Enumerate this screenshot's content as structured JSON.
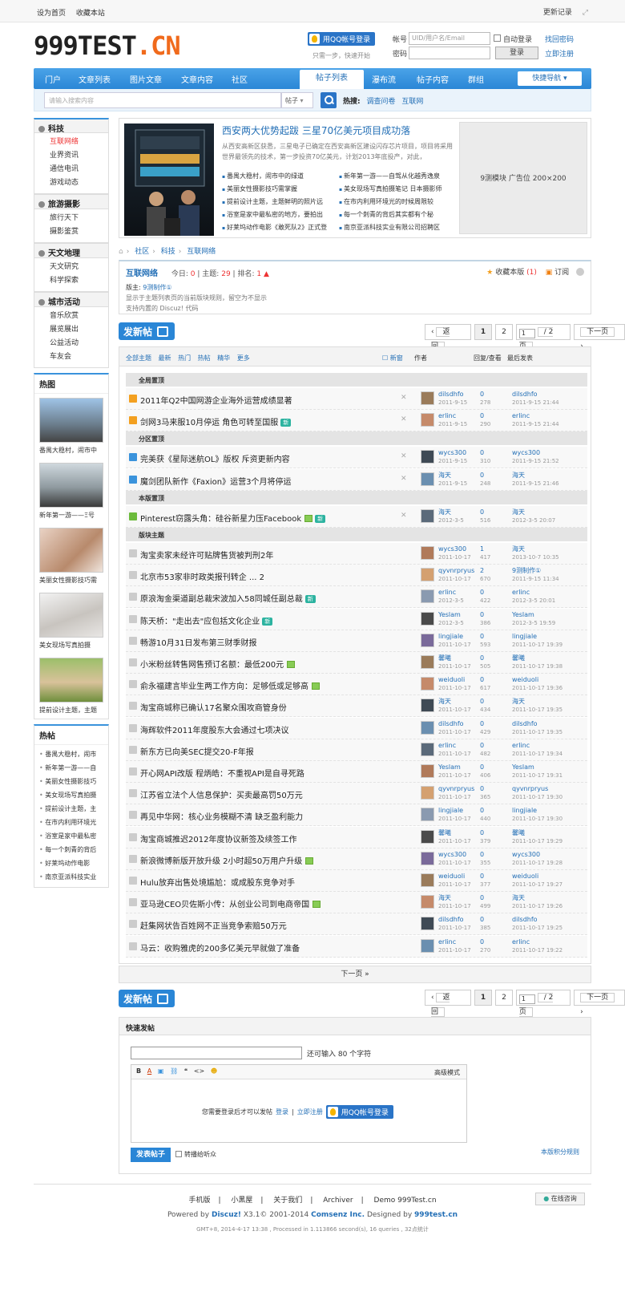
{
  "topbar": {
    "set_home": "设为首页",
    "bookmark": "收藏本站",
    "changelog": "更新记录"
  },
  "logo": {
    "main": "999TEST",
    "suffix": ".CN"
  },
  "login": {
    "qq_button": "用QQ帐号登录",
    "qq_hint": "只需一步，快速开始",
    "account_label": "帐号",
    "account_placeholder": "UID/用户名/Email",
    "auto_login": "自动登录",
    "find_password": "找回密码",
    "password_label": "密码",
    "login_button": "登录",
    "register": "立即注册"
  },
  "nav": {
    "items": [
      "门户",
      "文章列表",
      "图片文章",
      "文章内容",
      "社区",
      "帖子列表",
      "瀑布流",
      "帖子内容",
      "群组"
    ],
    "active": "帖子列表",
    "quick": "快捷导航"
  },
  "search": {
    "placeholder": "请输入搜索内容",
    "type": "帖子",
    "hot_label": "热搜:",
    "hot": [
      "调查问卷",
      "互联网"
    ]
  },
  "sidebar": {
    "groups": [
      {
        "title": "科技",
        "items": [
          "互联网络",
          "业界资讯",
          "通信电讯",
          "游戏动态"
        ],
        "current": "互联网络"
      },
      {
        "title": "旅游摄影",
        "items": [
          "旅行天下",
          "摄影鉴赏"
        ]
      },
      {
        "title": "天文地理",
        "items": [
          "天文研究",
          "科学探索"
        ]
      },
      {
        "title": "城市活动",
        "items": [
          "音乐欣赏",
          "展览展出",
          "公益活动",
          "车友会"
        ]
      }
    ],
    "hot_pic_title": "热图",
    "hot_pics": [
      "番禺大稳村，闹市中",
      "新年第一游——Ξ号",
      "美丽女性摄影技巧需",
      "美女现场写真拍摄",
      "提前设计主题，主题"
    ],
    "hot_post_title": "热帖",
    "hot_posts": [
      "番禺大稳村，闹市",
      "新年第一游——自",
      "美丽女性摄影技巧",
      "美女现场写真拍摄",
      "提前设计主题，主",
      "在市内利用环境光",
      "浴室是家中最私密",
      "每一个刺青的背后",
      "好莱坞动作电影",
      "南京亚派科技实业"
    ]
  },
  "featured": {
    "title": "西安两大优势起跋 三星70亿美元项目成功落",
    "desc": "从西安高新区获悉，三星电子已确定在西安高新区建设闪存芯片项目，项目将采用世界最领先的技术，第一步投资70亿美元，计划2013年底投产，对此，",
    "links": [
      "番禺大稳村，闹市中的绿道",
      "新年第一游——自驾从化越秀逸泉",
      "美丽女性摄影技巧需掌握",
      "美女现场写真拍摄笔记 日本摄影师",
      "提前设计主题，主题鲜明的照片远",
      "在市内利用环境光的时候周限较",
      "浴室是家中最私密的地方，要拍出",
      "每一个刺青的背后其实都有个秘",
      "好莱坞动作电影《敢死队2》正式登",
      "南京亚派科技实业有限公司招聘区"
    ],
    "ad": "9测模块 广告位 200×200"
  },
  "breadcrumb": [
    "社区",
    "科技",
    "互联网络"
  ],
  "forum": {
    "name": "互联网络",
    "today_label": "今日:",
    "today": "0",
    "topics_label": "主题:",
    "topics": "29",
    "rank_label": "排名:",
    "rank": "1",
    "moderator_label": "版主:",
    "moderator": "9测制作①",
    "favorite": "收藏本版",
    "favorite_count": "(1)",
    "subscribe": "订阅",
    "rule1": "显示于主题列表页的当前版块规则，留空为不显示",
    "rule2": "支持内置的 Discuz! 代码"
  },
  "toolbar": {
    "new_post": "发新帖",
    "back": "返 回",
    "page1": "1",
    "page2": "2",
    "page_input": "1",
    "page_total": "/ 2 页",
    "next": "下一页"
  },
  "threads": {
    "filters": [
      "全部主题",
      "最新",
      "热门",
      "热帖",
      "精华",
      "更多"
    ],
    "new_window": "新窗",
    "col_author": "作者",
    "col_reply": "回复/查看",
    "col_last": "最后发表",
    "sections": [
      "全局置顶",
      "分区置顶",
      "本版置顶",
      "版块主题"
    ],
    "rows": [
      {
        "title": "2011年Q2中国网游企业海外运营成绩显著",
        "tag": "",
        "img": false,
        "author": "dilsdhfo",
        "date": "2011-9-15",
        "reply": "0",
        "view": "278",
        "last": "dilsdhfo",
        "last_time": "2011-9-15 21:44",
        "x": true,
        "icon": "pin"
      },
      {
        "title": "剑网3马来服10月停运 角色可转至国服",
        "tag": "新",
        "img": false,
        "author": "erlinc",
        "date": "2011-9-15",
        "reply": "0",
        "view": "290",
        "last": "erlinc",
        "last_time": "2011-9-15 21:44",
        "x": true,
        "icon": "pin"
      },
      {
        "title": "完美获《星际迷航OL》版权 斥资更新内容",
        "tag": "",
        "img": false,
        "author": "wycs300",
        "date": "2011-9-15",
        "reply": "0",
        "view": "310",
        "last": "wycs300",
        "last_time": "2011-9-15 21:52",
        "x": true,
        "icon": "pin2"
      },
      {
        "title": "魔剑团队新作《Faxion》运营3个月将停运",
        "tag": "",
        "img": false,
        "author": "海天",
        "date": "2011-9-15",
        "reply": "0",
        "view": "248",
        "last": "海天",
        "last_time": "2011-9-15 21:46",
        "x": true,
        "icon": "pin2"
      },
      {
        "title": "Pinterest窃露头角：硅谷新星力压Facebook",
        "tag": "新",
        "img": true,
        "author": "海天",
        "date": "2012-3-5",
        "reply": "0",
        "view": "516",
        "last": "海天",
        "last_time": "2012-3-5 20:07",
        "x": true,
        "icon": "pin3"
      },
      {
        "title": "淘宝卖家未经许可贴牌售货被判刑2年",
        "tag": "",
        "img": false,
        "author": "wycs300",
        "date": "2011-10-17",
        "reply": "1",
        "view": "417",
        "last": "海天",
        "last_time": "2013-10-7 10:35",
        "x": false,
        "icon": ""
      },
      {
        "title": "北京市53家非时政类报刊转企  ... 2",
        "tag": "",
        "img": false,
        "author": "qyvnrpryus",
        "date": "2011-10-17",
        "reply": "2",
        "view": "670",
        "last": "9测制作①",
        "last_time": "2011-9-15 11:34",
        "x": false,
        "icon": ""
      },
      {
        "title": "原浪淘金渠道副总裁宋波加入58同城任副总裁",
        "tag": "新",
        "img": false,
        "author": "erlinc",
        "date": "2012-3-5",
        "reply": "0",
        "view": "422",
        "last": "erlinc",
        "last_time": "2012-3-5 20:01",
        "x": false,
        "icon": ""
      },
      {
        "title": "陈天桥：\"走出去\"应包括文化企业",
        "tag": "新",
        "img": false,
        "author": "Yeslam",
        "date": "2012-3-5",
        "reply": "0",
        "view": "386",
        "last": "Yeslam",
        "last_time": "2012-3-5 19:59",
        "x": false,
        "icon": ""
      },
      {
        "title": "畅游10月31日发布第三财季财报",
        "tag": "",
        "img": false,
        "author": "lingjiale",
        "date": "2011-10-17",
        "reply": "0",
        "view": "593",
        "last": "lingjiale",
        "last_time": "2011-10-17 19:39",
        "x": false,
        "icon": ""
      },
      {
        "title": "小米粉丝转售网售预订名额：最低200元",
        "tag": "",
        "img": true,
        "author": "馨曦",
        "date": "2011-10-17",
        "reply": "0",
        "view": "505",
        "last": "馨曦",
        "last_time": "2011-10-17 19:38",
        "x": false,
        "icon": ""
      },
      {
        "title": "俞永福建言毕业生两工作方向：足够低或足够高",
        "tag": "",
        "img": true,
        "author": "weiduoli",
        "date": "2011-10-17",
        "reply": "0",
        "view": "617",
        "last": "weiduoli",
        "last_time": "2011-10-17 19:36",
        "x": false,
        "icon": ""
      },
      {
        "title": "淘宝商城称已确认17名聚众围攻商管身份",
        "tag": "",
        "img": false,
        "author": "海天",
        "date": "2011-10-17",
        "reply": "0",
        "view": "434",
        "last": "海天",
        "last_time": "2011-10-17 19:35",
        "x": false,
        "icon": ""
      },
      {
        "title": "海辉软件2011年度股东大会通过七项决议",
        "tag": "",
        "img": false,
        "author": "dilsdhfo",
        "date": "2011-10-17",
        "reply": "0",
        "view": "429",
        "last": "dilsdhfo",
        "last_time": "2011-10-17 19:35",
        "x": false,
        "icon": ""
      },
      {
        "title": "新东方已向美SEC提交20-F年报",
        "tag": "",
        "img": false,
        "author": "erlinc",
        "date": "2011-10-17",
        "reply": "0",
        "view": "482",
        "last": "erlinc",
        "last_time": "2011-10-17 19:34",
        "x": false,
        "icon": ""
      },
      {
        "title": "开心网API改版 程炳皓：不重视API是自寻死路",
        "tag": "",
        "img": false,
        "author": "Yeslam",
        "date": "2011-10-17",
        "reply": "0",
        "view": "406",
        "last": "Yeslam",
        "last_time": "2011-10-17 19:31",
        "x": false,
        "icon": ""
      },
      {
        "title": "江苏省立法个人信息保护：买卖最高罚50万元",
        "tag": "",
        "img": false,
        "author": "qyvnrpryus",
        "date": "2011-10-17",
        "reply": "0",
        "view": "365",
        "last": "qyvnrpryus",
        "last_time": "2011-10-17 19:30",
        "x": false,
        "icon": ""
      },
      {
        "title": "再见中华网：核心业务模糊不清 缺乏盈利能力",
        "tag": "",
        "img": false,
        "author": "lingjiale",
        "date": "2011-10-17",
        "reply": "0",
        "view": "440",
        "last": "lingjiale",
        "last_time": "2011-10-17 19:30",
        "x": false,
        "icon": ""
      },
      {
        "title": "淘宝商城推迟2012年度协议新签及续签工作",
        "tag": "",
        "img": false,
        "author": "馨曦",
        "date": "2011-10-17",
        "reply": "0",
        "view": "379",
        "last": "馨曦",
        "last_time": "2011-10-17 19:29",
        "x": false,
        "icon": ""
      },
      {
        "title": "新浪微博新版开放升级 2小时超50万用户升级",
        "tag": "",
        "img": true,
        "author": "wycs300",
        "date": "2011-10-17",
        "reply": "0",
        "view": "355",
        "last": "wycs300",
        "last_time": "2011-10-17 19:28",
        "x": false,
        "icon": ""
      },
      {
        "title": "Hulu放弃出售处境尴尬：或成股东竞争对手",
        "tag": "",
        "img": false,
        "author": "weiduoli",
        "date": "2011-10-17",
        "reply": "0",
        "view": "377",
        "last": "weiduoli",
        "last_time": "2011-10-17 19:27",
        "x": false,
        "icon": ""
      },
      {
        "title": "亚马逊CEO贝佐斯小传：从创业公司到电商帝国",
        "tag": "",
        "img": true,
        "author": "海天",
        "date": "2011-10-17",
        "reply": "0",
        "view": "499",
        "last": "海天",
        "last_time": "2011-10-17 19:26",
        "x": false,
        "icon": ""
      },
      {
        "title": "赶集网状告百姓网不正当竞争索赔50万元",
        "tag": "",
        "img": false,
        "author": "dilsdhfo",
        "date": "2011-10-17",
        "reply": "0",
        "view": "385",
        "last": "dilsdhfo",
        "last_time": "2011-10-17 19:25",
        "x": false,
        "icon": ""
      },
      {
        "title": "马云：收购雅虎的200多亿美元早就做了准备",
        "tag": "",
        "img": false,
        "author": "erlinc",
        "date": "2011-10-17",
        "reply": "0",
        "view": "270",
        "last": "erlinc",
        "last_time": "2011-10-17 19:22",
        "x": false,
        "icon": ""
      }
    ]
  },
  "next_page": "下一页 »",
  "quickpost": {
    "title": "快速发帖",
    "count_text": "还可输入 80 个字符",
    "advanced": "高级模式",
    "login_prompt": "您需要登录后才可以发帖",
    "login": "登录",
    "register": "立即注册",
    "qq_login": "用QQ帐号登录",
    "submit": "发表帖子",
    "broadcast": "转播给听众",
    "rules": "本版积分规则"
  },
  "footer": {
    "links": [
      "手机版",
      "小黑屋",
      "关于我们",
      "Archiver",
      "Demo 999Test.cn"
    ],
    "powered_prefix": "Powered by",
    "discuz": "Discuz!",
    "version": "X3.1© 2001-2014",
    "company": "Comsenz Inc.",
    "designed": "Designed by",
    "designer": "999test.cn",
    "gmt": "GMT+8, 2014-4-17 13:38 , Processed in 1.113866 second(s), 16 queries , 32点统计",
    "online": "在线咨询"
  }
}
